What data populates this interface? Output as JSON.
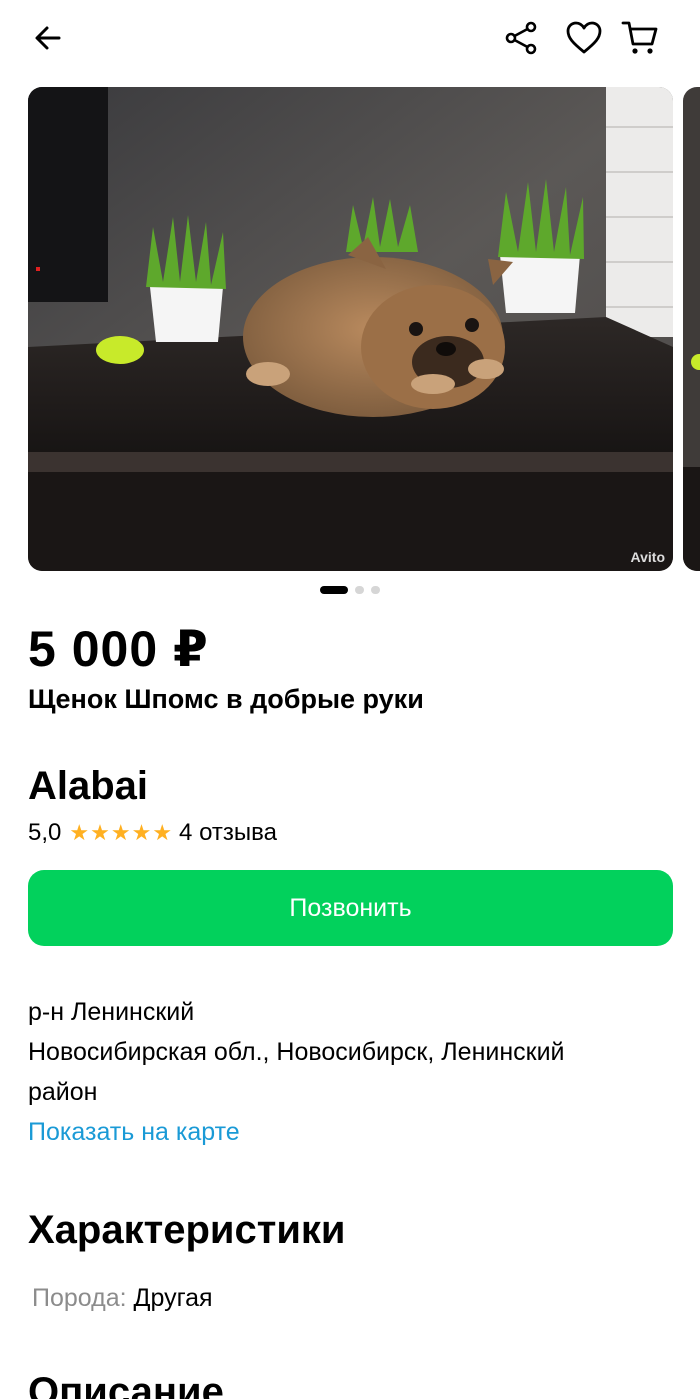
{
  "header": {
    "icons": [
      "back-arrow-icon",
      "share-icon",
      "heart-icon",
      "cart-icon"
    ]
  },
  "gallery": {
    "watermark": "Avito",
    "total_photos": 3,
    "current_photo": 1
  },
  "listing": {
    "price": "5 000 ₽",
    "title": "Щенок Шпомс в добрые руки"
  },
  "seller": {
    "name": "Alabai",
    "rating": "5,0",
    "stars": 5,
    "reviews": "4 отзыва"
  },
  "actions": {
    "call_label": "Позвонить"
  },
  "location": {
    "district": "р-н Ленинский",
    "address_line1": "Новосибирская обл., Новосибирск, Ленинский",
    "address_line2": "район",
    "map_link": "Показать на карте"
  },
  "characteristics": {
    "title": "Характеристики",
    "items": [
      {
        "key": "Порода:",
        "value": "Другая"
      }
    ]
  },
  "description": {
    "title": "Описание"
  },
  "colors": {
    "call_button": "#02d15c",
    "link": "#1a9ad6",
    "star": "#ffb021"
  }
}
